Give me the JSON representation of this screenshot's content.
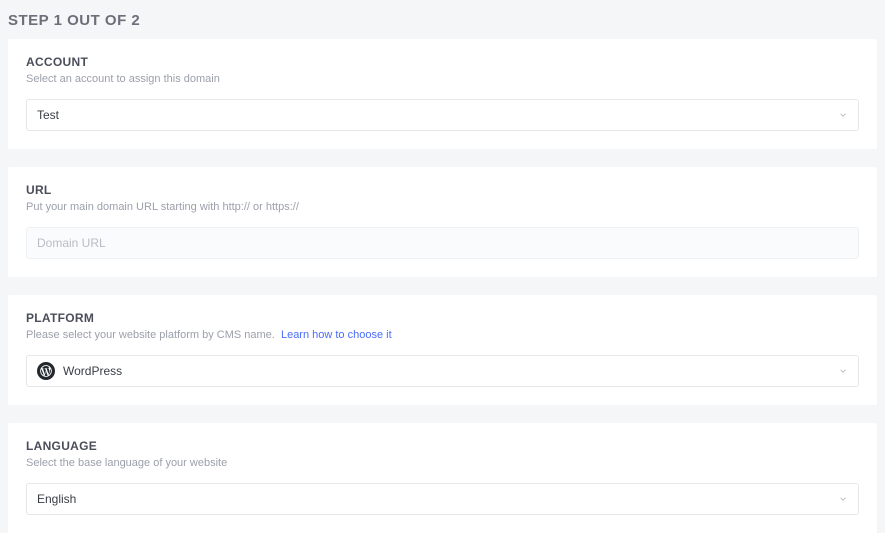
{
  "page": {
    "title": "STEP 1 OUT OF 2"
  },
  "account": {
    "title": "ACCOUNT",
    "description": "Select an account to assign this domain",
    "selected": "Test"
  },
  "url": {
    "title": "URL",
    "description": "Put your main domain URL starting with http:// or https://",
    "placeholder": "Domain URL",
    "value": ""
  },
  "platform": {
    "title": "PLATFORM",
    "description_prefix": "Please select your website platform by CMS name.",
    "link_text": "Learn how to choose it",
    "selected": "WordPress"
  },
  "language": {
    "title": "LANGUAGE",
    "description": "Select the base language of your website",
    "selected": "English"
  }
}
